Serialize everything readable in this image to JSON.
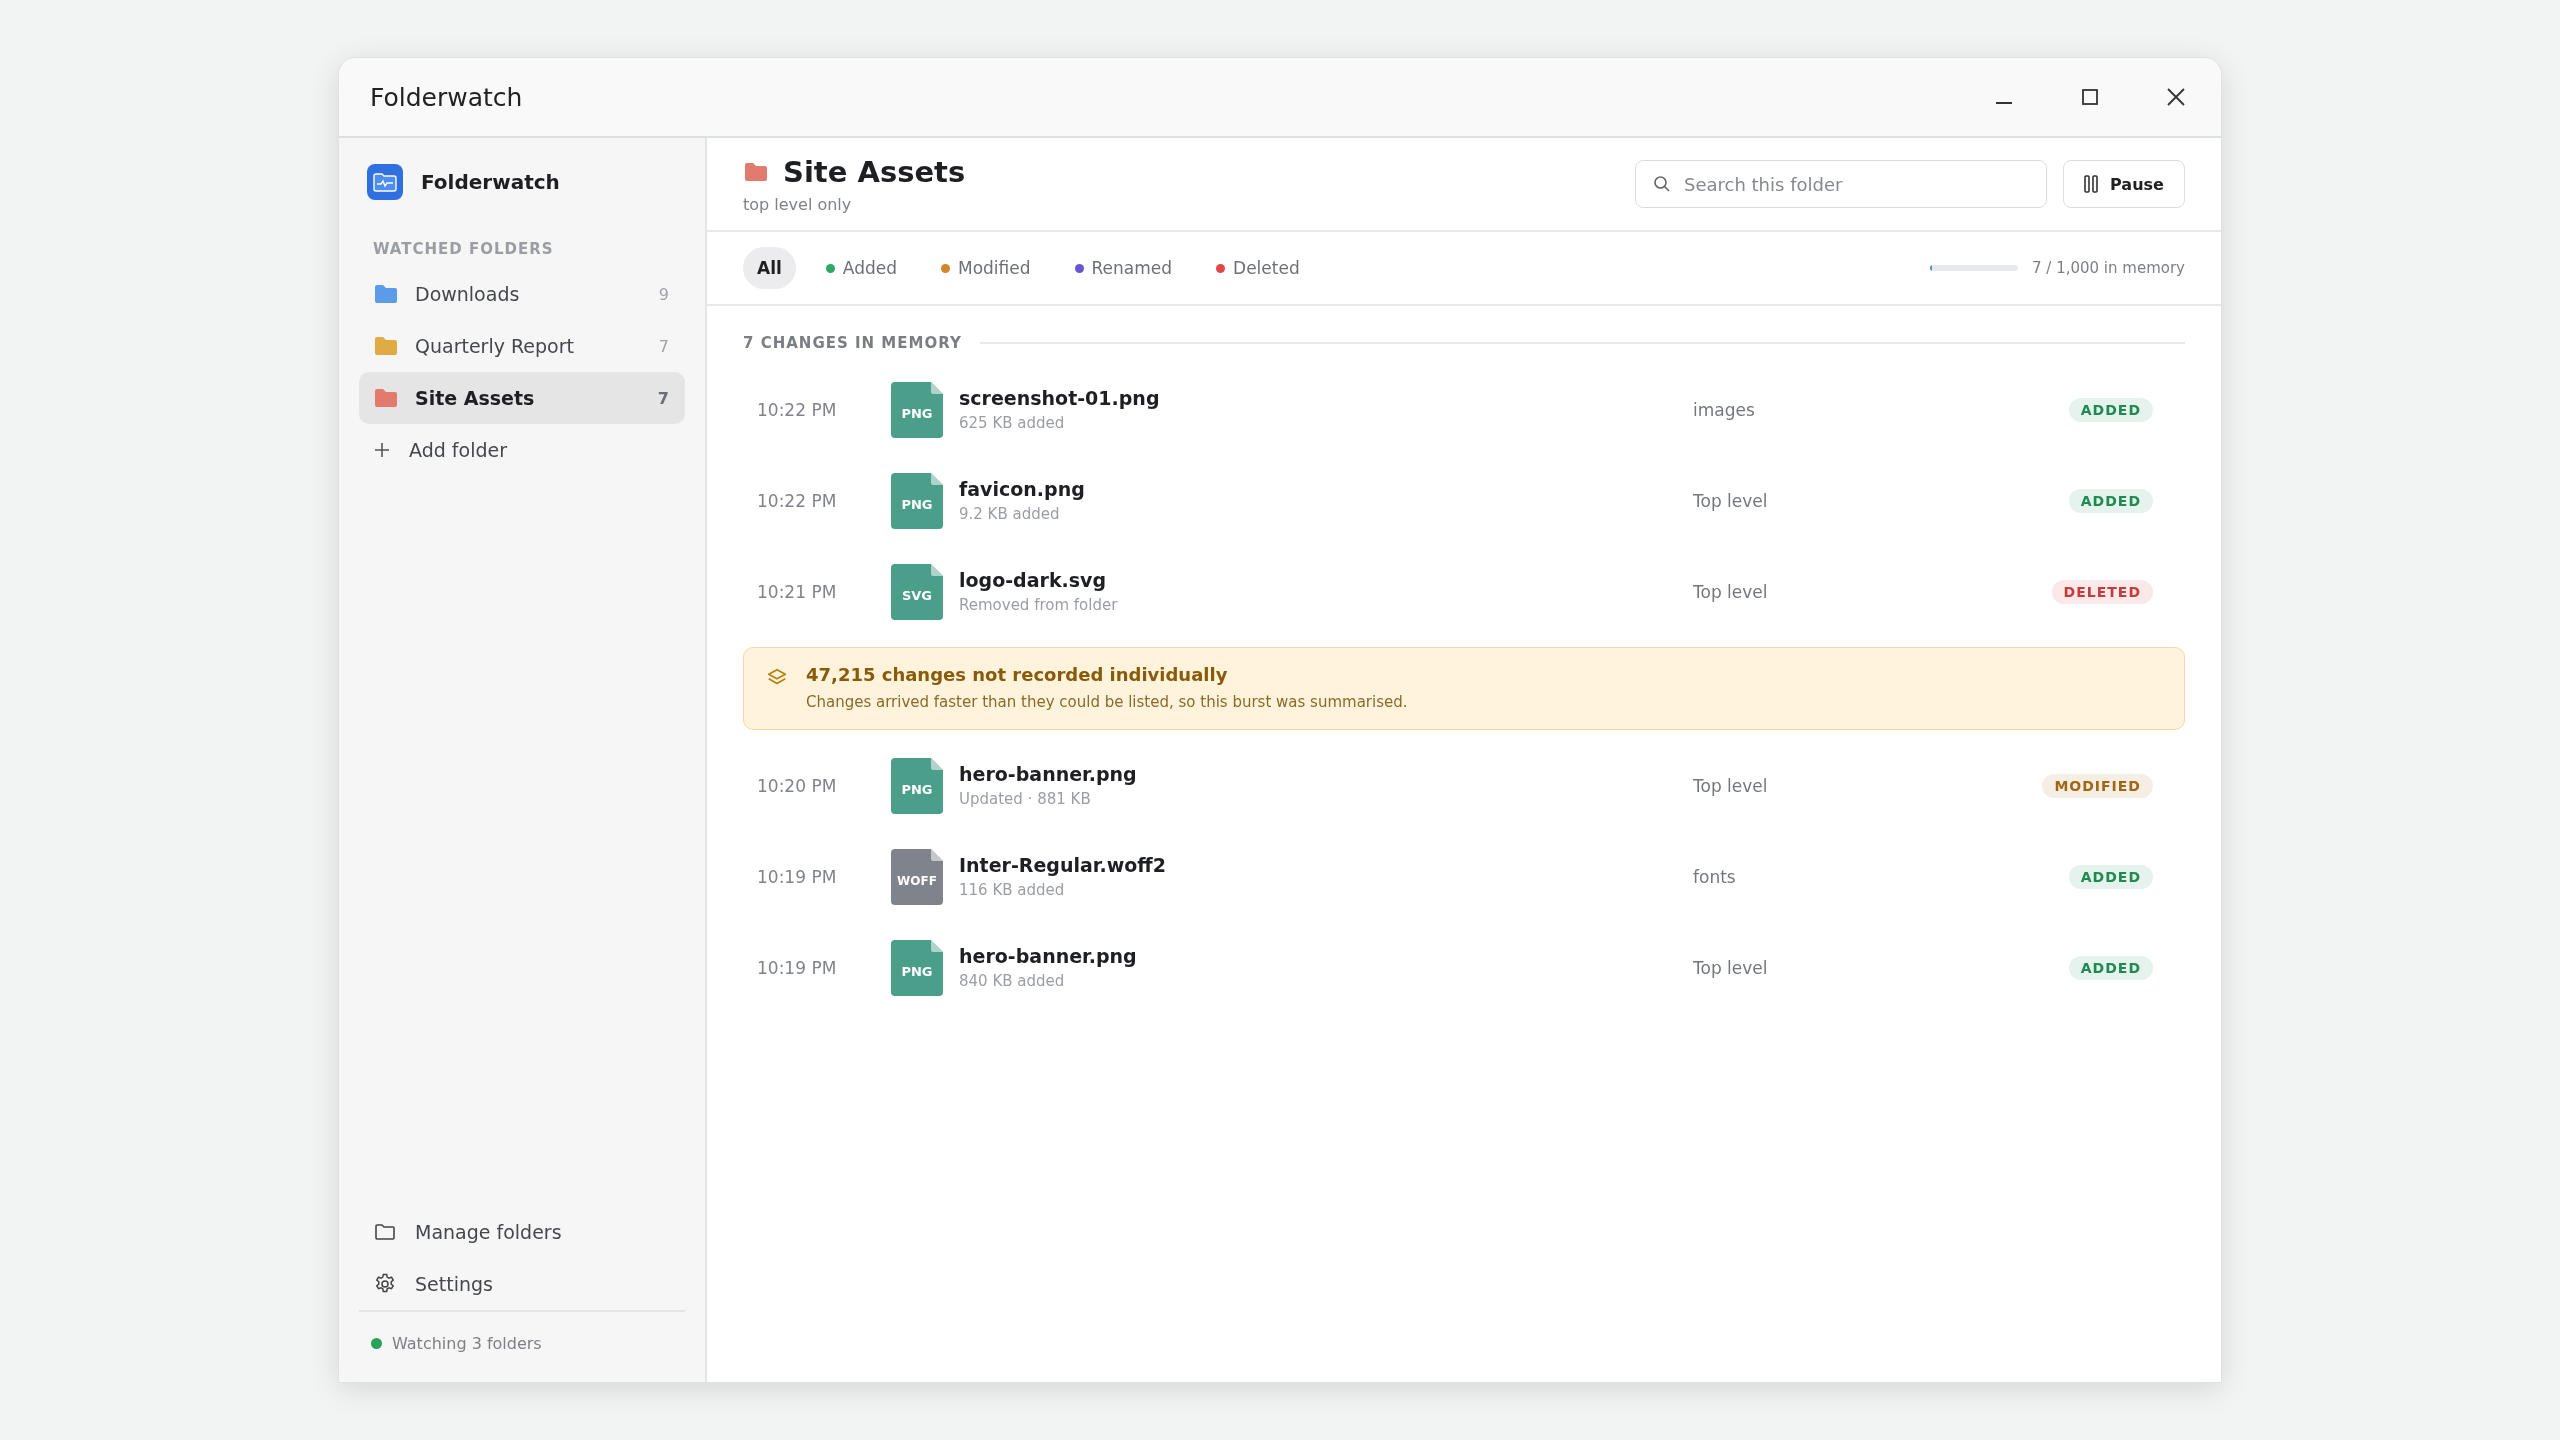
{
  "window": {
    "title": "Folderwatch"
  },
  "sidebar": {
    "app_name": "Folderwatch",
    "section_label": "WATCHED FOLDERS",
    "folders": [
      {
        "name": "Downloads",
        "count": "9",
        "color": "#5b9be8",
        "selected": false
      },
      {
        "name": "Quarterly Report",
        "count": "7",
        "color": "#e0aa45",
        "selected": false
      },
      {
        "name": "Site Assets",
        "count": "7",
        "color": "#e27a6e",
        "selected": true
      }
    ],
    "add_label": "Add folder",
    "footer_items": [
      {
        "kind": "folder",
        "label": "Manage folders"
      },
      {
        "kind": "settings",
        "label": "Settings"
      }
    ],
    "status": "Watching 3 folders"
  },
  "header": {
    "title": "Site Assets",
    "subtitle": "top level only",
    "search": {
      "placeholder": "Search this folder"
    },
    "pause_label": "Pause"
  },
  "filters": [
    {
      "label": "All",
      "selected": true
    },
    {
      "label": "Added",
      "color": "#2fa866",
      "selected": false
    },
    {
      "label": "Modified",
      "color": "#d4852a",
      "selected": false
    },
    {
      "label": "Renamed",
      "color": "#6a55d0",
      "selected": false
    },
    {
      "label": "Deleted",
      "color": "#e04848",
      "selected": false
    }
  ],
  "memory": {
    "level": 0.007,
    "reading": "7 / 1,000 in memory"
  },
  "list": {
    "heading": "7 CHANGES IN MEMORY",
    "items": [
      {
        "kind": "change",
        "time": "10:22 PM",
        "ext": "PNG",
        "color": "#4a9e8a",
        "file": "screenshot-01.png",
        "detail": "625 KB added",
        "location": "images",
        "badge": {
          "text": "ADDED",
          "color": "#1f8a52"
        }
      },
      {
        "kind": "change",
        "time": "10:22 PM",
        "ext": "PNG",
        "color": "#4a9e8a",
        "file": "favicon.png",
        "detail": "9.2 KB added",
        "location": "Top level",
        "badge": {
          "text": "ADDED",
          "color": "#1f8a52"
        }
      },
      {
        "kind": "change",
        "time": "10:21 PM",
        "ext": "SVG",
        "color": "#4a9e8a",
        "file": "logo-dark.svg",
        "detail": "Removed from folder",
        "location": "Top level",
        "badge": {
          "text": "DELETED",
          "color": "#c9393b"
        }
      },
      {
        "kind": "burst",
        "title": "47,215 changes not recorded individually",
        "detail": "Changes arrived faster than they could be listed, so this burst was summarised."
      },
      {
        "kind": "change",
        "time": "10:20 PM",
        "ext": "PNG",
        "color": "#4a9e8a",
        "file": "hero-banner.png",
        "detail": "Updated · 881 KB",
        "location": "Top level",
        "badge": {
          "text": "MODIFIED",
          "color": "#a5640f"
        }
      },
      {
        "kind": "change",
        "time": "10:19 PM",
        "ext": "WOFF",
        "color": "#7f838c",
        "file": "Inter-Regular.woff2",
        "detail": "116 KB added",
        "location": "fonts",
        "badge": {
          "text": "ADDED",
          "color": "#1f8a52"
        }
      },
      {
        "kind": "change",
        "time": "10:19 PM",
        "ext": "PNG",
        "color": "#4a9e8a",
        "file": "hero-banner.png",
        "detail": "840 KB added",
        "location": "Top level",
        "badge": {
          "text": "ADDED",
          "color": "#1f8a52"
        }
      }
    ]
  }
}
